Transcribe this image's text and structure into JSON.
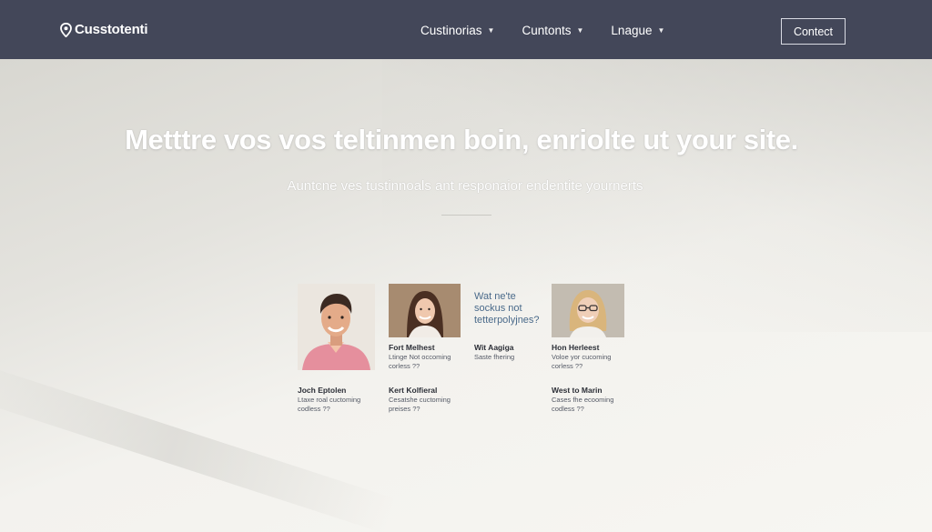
{
  "header": {
    "logo_text": "Cusstotenti",
    "logo_icon": "map-pin-icon",
    "nav": [
      {
        "label": "Custinorias",
        "icon": "chevron-down-icon"
      },
      {
        "label": "Cuntonts",
        "icon": "chevron-down-icon"
      },
      {
        "label": "Lnague",
        "icon": "chevron-down-icon"
      }
    ],
    "contact_label": "Contect"
  },
  "hero": {
    "title": "Metttre vos vos teltinmen boin, enriolte ut your site.",
    "subtitle": "Auntcne ves tustinnoals ant responaior endentite yournerts"
  },
  "testimonials": [
    {
      "name": "Joch Eptolen",
      "desc": "Ltaxe roal cuctoming\ncodless ??"
    },
    {
      "name": "Fort Melhest",
      "desc": "Ltinge Not occoming\ncorless ??"
    },
    {
      "name": "Kert Kolfieral",
      "desc": "Cesatshe cuctoming\npreises ??"
    },
    {
      "name": "Wit Aagiga",
      "desc": "Saste fhering"
    },
    {
      "name": "Hon Herleest",
      "desc": "Voloe yor cucoming\ncorless ??"
    },
    {
      "name": "West to Marin",
      "desc": "Cases fhe ecooming\ncodless ??"
    }
  ],
  "question": "Wat ne'te\nsockus not\ntetterpolyjnes?"
}
